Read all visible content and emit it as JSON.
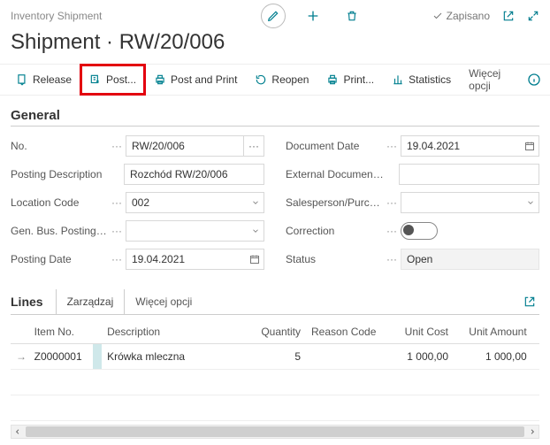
{
  "breadcrumb": "Inventory Shipment",
  "saved_label": "Zapisano",
  "title": "Shipment · RW/20/006",
  "actions": {
    "release": "Release",
    "post": "Post...",
    "post_print": "Post and Print",
    "reopen": "Reopen",
    "print": "Print...",
    "statistics": "Statistics",
    "more": "Więcej opcji"
  },
  "general": {
    "heading": "General",
    "fields": {
      "no": {
        "label": "No.",
        "value": "RW/20/006"
      },
      "posting_desc": {
        "label": "Posting Description",
        "value": "Rozchód RW/20/006"
      },
      "location_code": {
        "label": "Location Code",
        "value": "002"
      },
      "gbpg": {
        "label": "Gen. Bus. Posting Gro...",
        "value": ""
      },
      "posting_date": {
        "label": "Posting Date",
        "value": "19.04.2021"
      },
      "doc_date": {
        "label": "Document Date",
        "value": "19.04.2021"
      },
      "ext_doc_no": {
        "label": "External Document No.",
        "value": ""
      },
      "salesperson": {
        "label": "Salesperson/Purchase...",
        "value": ""
      },
      "correction": {
        "label": "Correction"
      },
      "status": {
        "label": "Status",
        "value": "Open"
      }
    }
  },
  "lines": {
    "heading": "Lines",
    "manage_tab": "Zarządzaj",
    "more": "Więcej opcji",
    "columns": {
      "item_no": "Item No.",
      "description": "Description",
      "quantity": "Quantity",
      "reason_code": "Reason Code",
      "unit_cost": "Unit Cost",
      "unit_amount": "Unit Amount"
    },
    "rows": [
      {
        "item_no": "Z0000001",
        "description": "Krówka mleczna",
        "quantity": "5",
        "reason_code": "",
        "unit_cost": "1 000,00",
        "unit_amount": "1 000,00"
      }
    ]
  }
}
